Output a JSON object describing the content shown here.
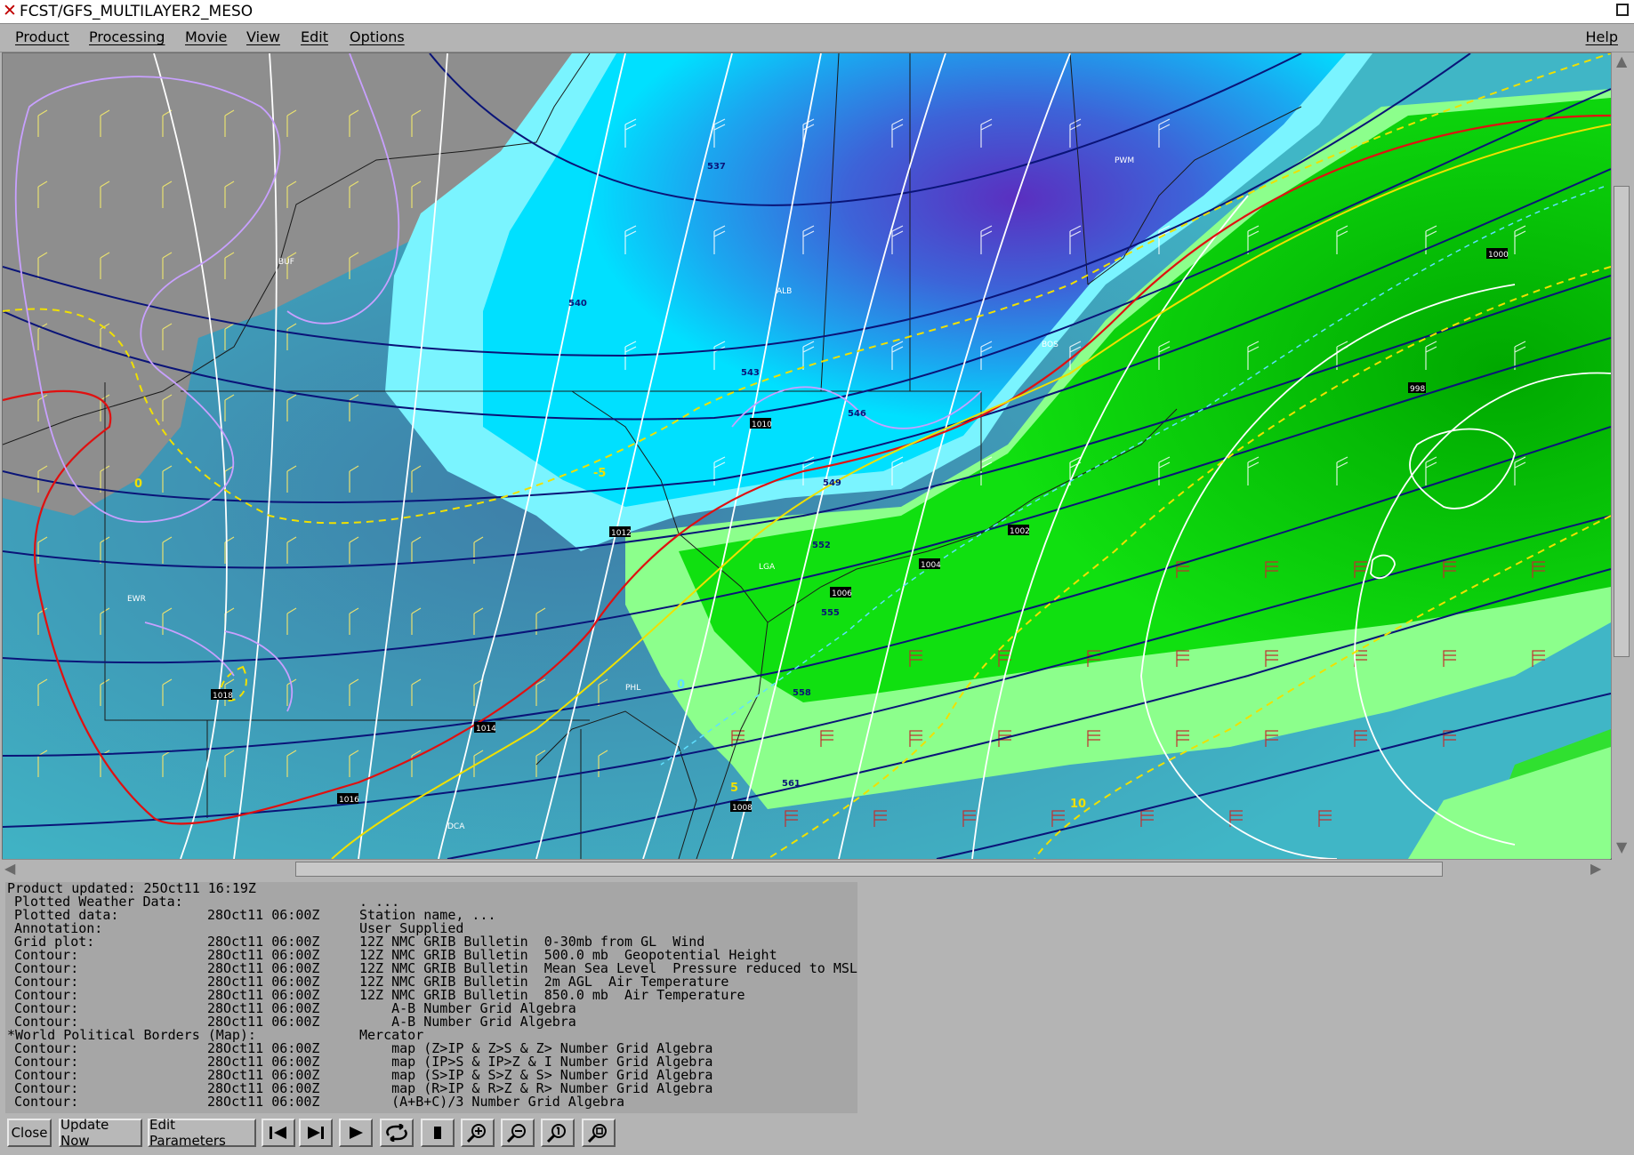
{
  "window": {
    "title": "FCST/GFS_MULTILAYER2_MESO"
  },
  "menubar": {
    "items": [
      "Product",
      "Processing",
      "Movie",
      "View",
      "Edit",
      "Options"
    ],
    "help": "Help"
  },
  "map": {
    "station_labels": [
      "BUF",
      "ALB",
      "PWM",
      "BOS",
      "LGA",
      "PHL",
      "DCA",
      "EWR"
    ],
    "height_labels": [
      "537",
      "540",
      "543",
      "546",
      "549",
      "552",
      "555",
      "558",
      "561"
    ],
    "pressure_labels": [
      "1000",
      "998",
      "1002",
      "1004",
      "1006",
      "1008",
      "1010",
      "1012",
      "1014",
      "1016",
      "1018"
    ],
    "temp_labels": [
      "-5",
      "0",
      "5",
      "10"
    ],
    "colors": {
      "snow_deep": "#5a2fc0",
      "snow_light": "#00f0ff",
      "rain": "#00d400",
      "rain_light": "#90ff90",
      "ocean": "#3b9bb5",
      "land": "#8a8a8a",
      "height_contour": "#0a1478",
      "isobar": "#ffffff",
      "freezing_line": "#e01010",
      "temp_line": "#f0e000",
      "boundary": "#c8a0ff"
    }
  },
  "info": {
    "header": "Product updated: 25Oct11 16:19Z",
    "rows": [
      {
        "label": "Plotted Weather Data:",
        "time": "",
        "desc": ". ..."
      },
      {
        "label": "Plotted data:",
        "time": "28Oct11 06:00Z",
        "desc": "Station name, ..."
      },
      {
        "label": "Annotation:",
        "time": "",
        "desc": "User Supplied"
      },
      {
        "label": "Grid plot:",
        "time": "28Oct11 06:00Z",
        "desc": "12Z NMC GRIB Bulletin  0-30mb from GL  Wind"
      },
      {
        "label": "Contour:",
        "time": "28Oct11 06:00Z",
        "desc": "12Z NMC GRIB Bulletin  500.0 mb  Geopotential Height"
      },
      {
        "label": "Contour:",
        "time": "28Oct11 06:00Z",
        "desc": "12Z NMC GRIB Bulletin  Mean Sea Level  Pressure reduced to MSL"
      },
      {
        "label": "Contour:",
        "time": "28Oct11 06:00Z",
        "desc": "12Z NMC GRIB Bulletin  2m AGL  Air Temperature"
      },
      {
        "label": "Contour:",
        "time": "28Oct11 06:00Z",
        "desc": "12Z NMC GRIB Bulletin  850.0 mb  Air Temperature"
      },
      {
        "label": "Contour:",
        "time": "28Oct11 06:00Z",
        "desc": "    A-B Number Grid Algebra"
      },
      {
        "label": "Contour:",
        "time": "28Oct11 06:00Z",
        "desc": "    A-B Number Grid Algebra"
      },
      {
        "label": "*World Political Borders (Map):",
        "time": "",
        "desc": "Mercator"
      },
      {
        "label": "Contour:",
        "time": "28Oct11 06:00Z",
        "desc": "    map (Z>IP & Z>S & Z> Number Grid Algebra"
      },
      {
        "label": "Contour:",
        "time": "28Oct11 06:00Z",
        "desc": "    map (IP>S & IP>Z & I Number Grid Algebra"
      },
      {
        "label": "Contour:",
        "time": "28Oct11 06:00Z",
        "desc": "    map (S>IP & S>Z & S> Number Grid Algebra"
      },
      {
        "label": "Contour:",
        "time": "28Oct11 06:00Z",
        "desc": "    map (R>IP & R>Z & R> Number Grid Algebra"
      },
      {
        "label": "Contour:",
        "time": "28Oct11 06:00Z",
        "desc": "    (A+B+C)/3 Number Grid Algebra"
      }
    ]
  },
  "toolbar": {
    "close": "Close",
    "update": "Update Now",
    "edit": "Edit Parameters",
    "icons": [
      "first-frame-icon",
      "next-frame-icon",
      "play-icon",
      "loop-icon",
      "stop-icon",
      "zoom-in-icon",
      "zoom-out-icon",
      "zoom-reset-icon",
      "zoom-fit-icon"
    ]
  }
}
